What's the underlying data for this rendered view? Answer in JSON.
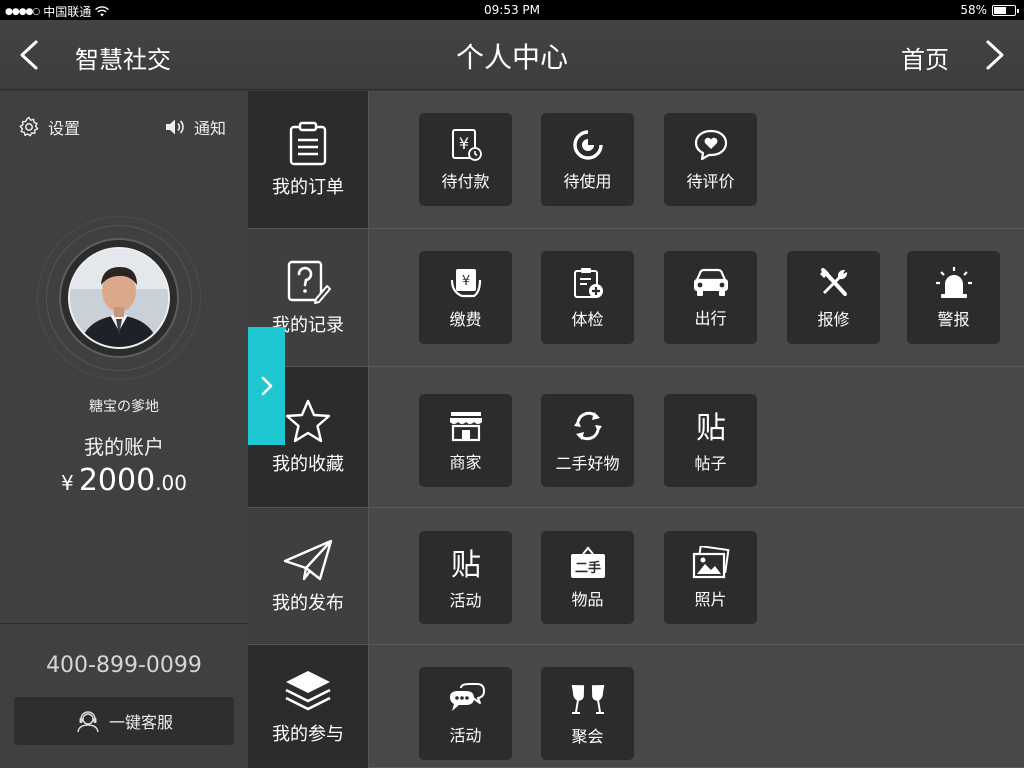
{
  "status_bar": {
    "signal_dots": "●●●●○",
    "carrier": "中国联通",
    "wifi_icon": "wifi-icon",
    "time": "09:53 PM",
    "battery_level": "58%",
    "battery_fraction": 0.58
  },
  "nav": {
    "back_label": "智慧社交",
    "title": "个人中心",
    "home_label": "首页"
  },
  "sidebar": {
    "settings_label": "设置",
    "notice_label": "通知",
    "username": "糖宝の爹地",
    "account_label": "我的账户",
    "currency": "¥",
    "balance_main": "2000",
    "balance_decimal": ".00",
    "phone": "400-899-0099",
    "service_label": "一键客服"
  },
  "categories": [
    {
      "label": "我的订单",
      "icon": "clipboard-icon"
    },
    {
      "label": "我的记录",
      "icon": "question-note-icon"
    },
    {
      "label": "我的收藏",
      "icon": "star-icon"
    },
    {
      "label": "我的发布",
      "icon": "paper-plane-icon"
    },
    {
      "label": "我的参与",
      "icon": "layers-icon"
    }
  ],
  "rows": [
    [
      {
        "label": "待付款",
        "icon": "yen-clock-icon"
      },
      {
        "label": "待使用",
        "icon": "pie-icon"
      },
      {
        "label": "待评价",
        "icon": "heart-bubble-icon"
      }
    ],
    [
      {
        "label": "缴费",
        "icon": "hand-yen-icon"
      },
      {
        "label": "体检",
        "icon": "medical-clipboard-icon"
      },
      {
        "label": "出行",
        "icon": "car-icon"
      },
      {
        "label": "报修",
        "icon": "tools-icon"
      },
      {
        "label": "警报",
        "icon": "alarm-light-icon"
      }
    ],
    [
      {
        "label": "商家",
        "icon": "shop-icon"
      },
      {
        "label": "二手好物",
        "icon": "recycle-icon"
      },
      {
        "label": "帖子",
        "icon": "post-icon"
      }
    ],
    [
      {
        "label": "活动",
        "icon": "post-icon"
      },
      {
        "label": "物品",
        "icon": "secondhand-sign-icon"
      },
      {
        "label": "照片",
        "icon": "photos-icon"
      }
    ],
    [
      {
        "label": "活动",
        "icon": "chat-bubbles-icon"
      },
      {
        "label": "聚会",
        "icon": "cheers-icon"
      }
    ]
  ],
  "icon_glyphs": {
    "post_char": "贴",
    "secondhand_char": "二手",
    "yen_char": "¥"
  },
  "colors": {
    "accent": "#1fc7d0",
    "tile_bg": "#2c2c2c",
    "row_bg": "#484848",
    "sidebar_bg": "#404040"
  }
}
